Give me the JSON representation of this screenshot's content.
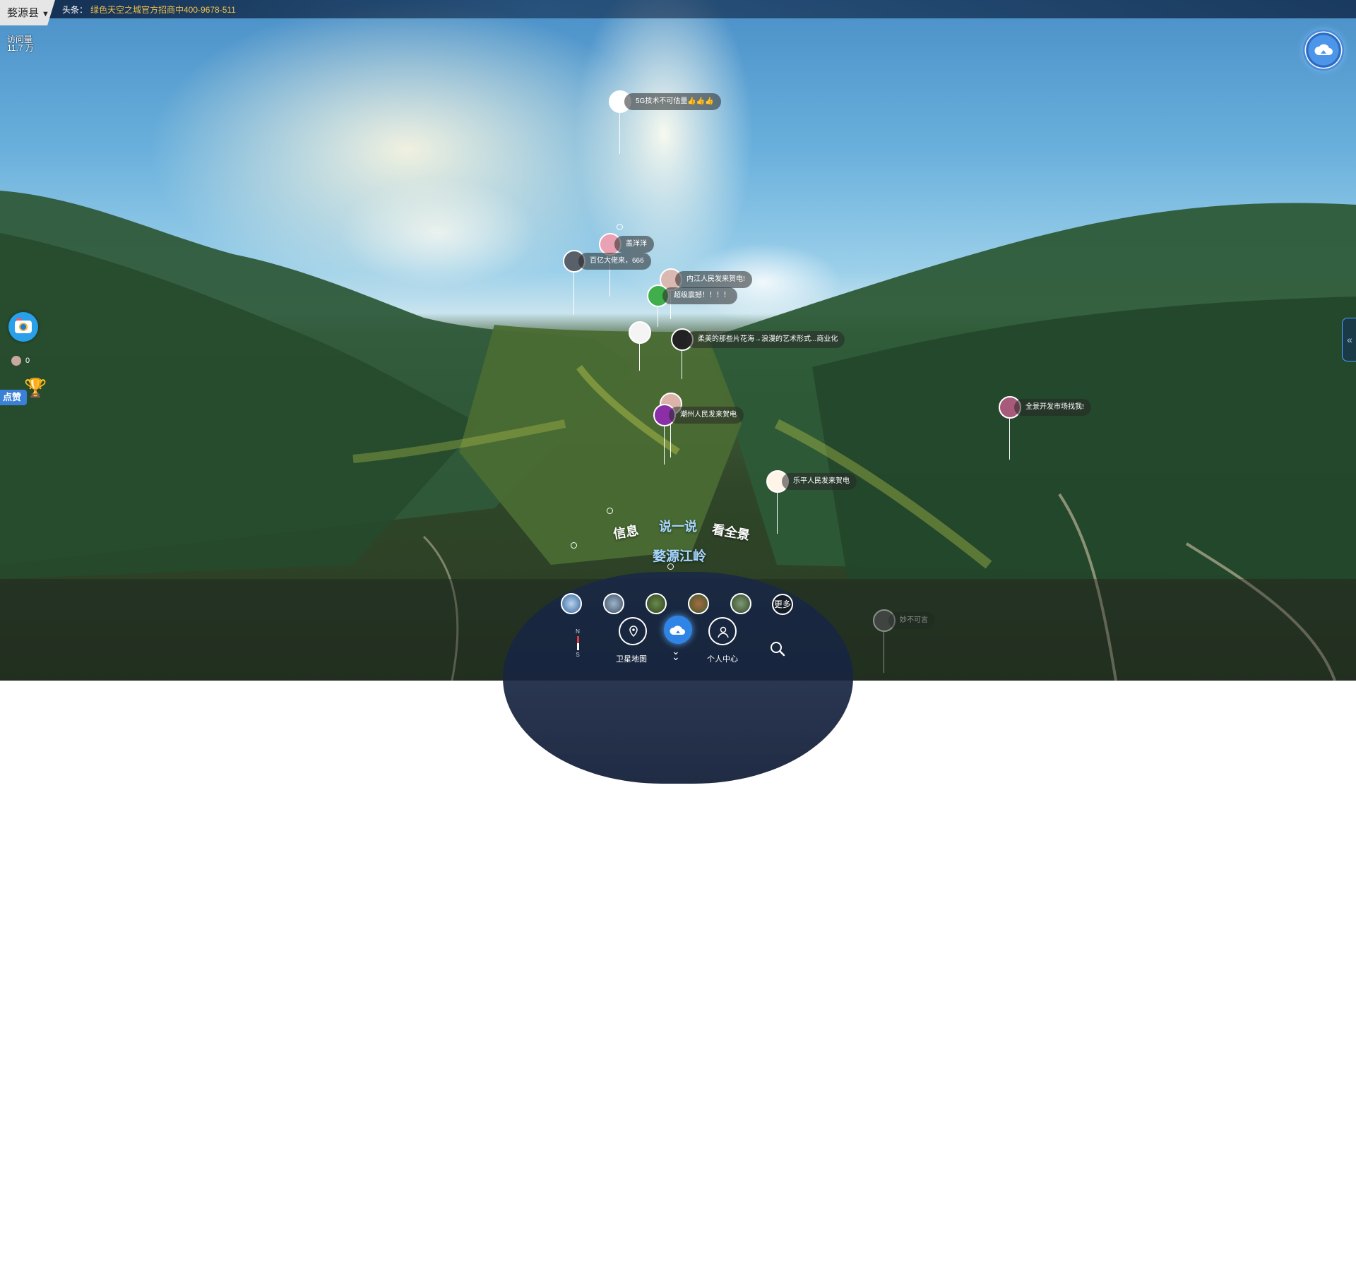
{
  "topbar": {
    "county": "婺源县",
    "headline_label": "头条：",
    "headline_text": "绿色天空之城官方招商中400-9678-511"
  },
  "stats": {
    "views_label": "访问量",
    "views_value": "11.7 万"
  },
  "left_tools": {
    "count": "0",
    "rank_label": "点赞"
  },
  "side_tab": {
    "icon": "chevrons-left-icon",
    "label": "«"
  },
  "pins": [
    {
      "text": "5G技术不可估量👍👍👍"
    },
    {
      "text": "盖洋洋"
    },
    {
      "text": "百亿大佬来，666"
    },
    {
      "text": "内江人民发来贺电!"
    },
    {
      "text": "超级震撼！！！！"
    },
    {
      "text": ""
    },
    {
      "text": "柔美的那些片花海→浪漫的艺术形式...商业化"
    },
    {
      "text": ""
    },
    {
      "text": "潮州人民发来贺电"
    },
    {
      "text": "全景开发市场找我!"
    },
    {
      "text": "乐平人民发来贺电"
    },
    {
      "text": "妙不可言"
    }
  ],
  "modes": {
    "info": "信息",
    "talk": "说一说",
    "pano": "看全景"
  },
  "scene_name": "婺源江岭",
  "thumbnails": {
    "more": "更多"
  },
  "nav": {
    "satellite_map": "卫星地图",
    "personal_center": "个人中心",
    "compass_n": "N",
    "compass_s": "S"
  },
  "colors": {
    "accent_blue": "#2f85e6",
    "headline_orange": "#f2c04a",
    "active_mode": "#a6d6ff"
  }
}
